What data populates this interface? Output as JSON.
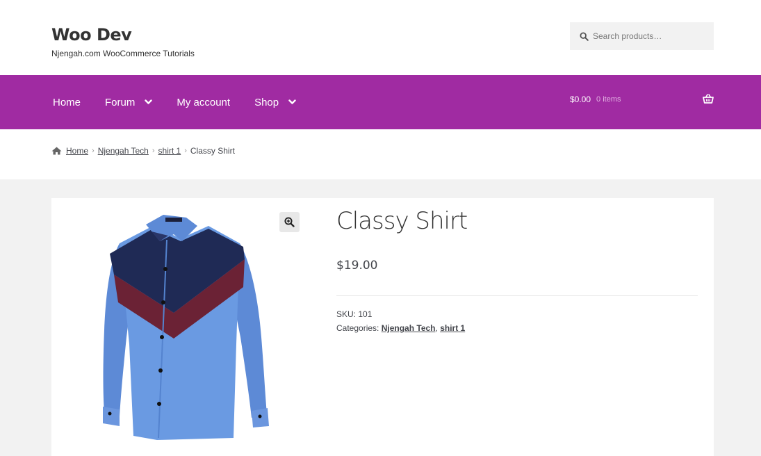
{
  "site": {
    "title": "Woo Dev",
    "tagline": "Njengah.com WooCommerce Tutorials"
  },
  "search": {
    "placeholder": "Search products…"
  },
  "nav": {
    "items": [
      {
        "label": "Home",
        "has_dropdown": false
      },
      {
        "label": "Forum",
        "has_dropdown": true
      },
      {
        "label": "My account",
        "has_dropdown": false
      },
      {
        "label": "Shop",
        "has_dropdown": true
      }
    ],
    "cart_amount": "$0.00",
    "cart_count": "0 items"
  },
  "breadcrumb": {
    "items": [
      "Home",
      "Njengah Tech",
      "shirt 1"
    ],
    "current": "Classy Shirt"
  },
  "product": {
    "title": "Classy Shirt",
    "price": "$19.00",
    "sku_label": "SKU:",
    "sku": "101",
    "categories_label": "Categories:",
    "categories": [
      "Njengah Tech",
      "shirt 1"
    ],
    "category_separator": ","
  },
  "colors": {
    "nav_bg": "#a02ba2",
    "content_bg": "#f2f2f2",
    "search_bg": "#f2f2f2"
  },
  "icons": {
    "search": "search-icon",
    "cart": "basket-icon",
    "home": "home-icon",
    "zoom": "zoom-in-icon",
    "dropdown": "chevron-down-icon"
  }
}
